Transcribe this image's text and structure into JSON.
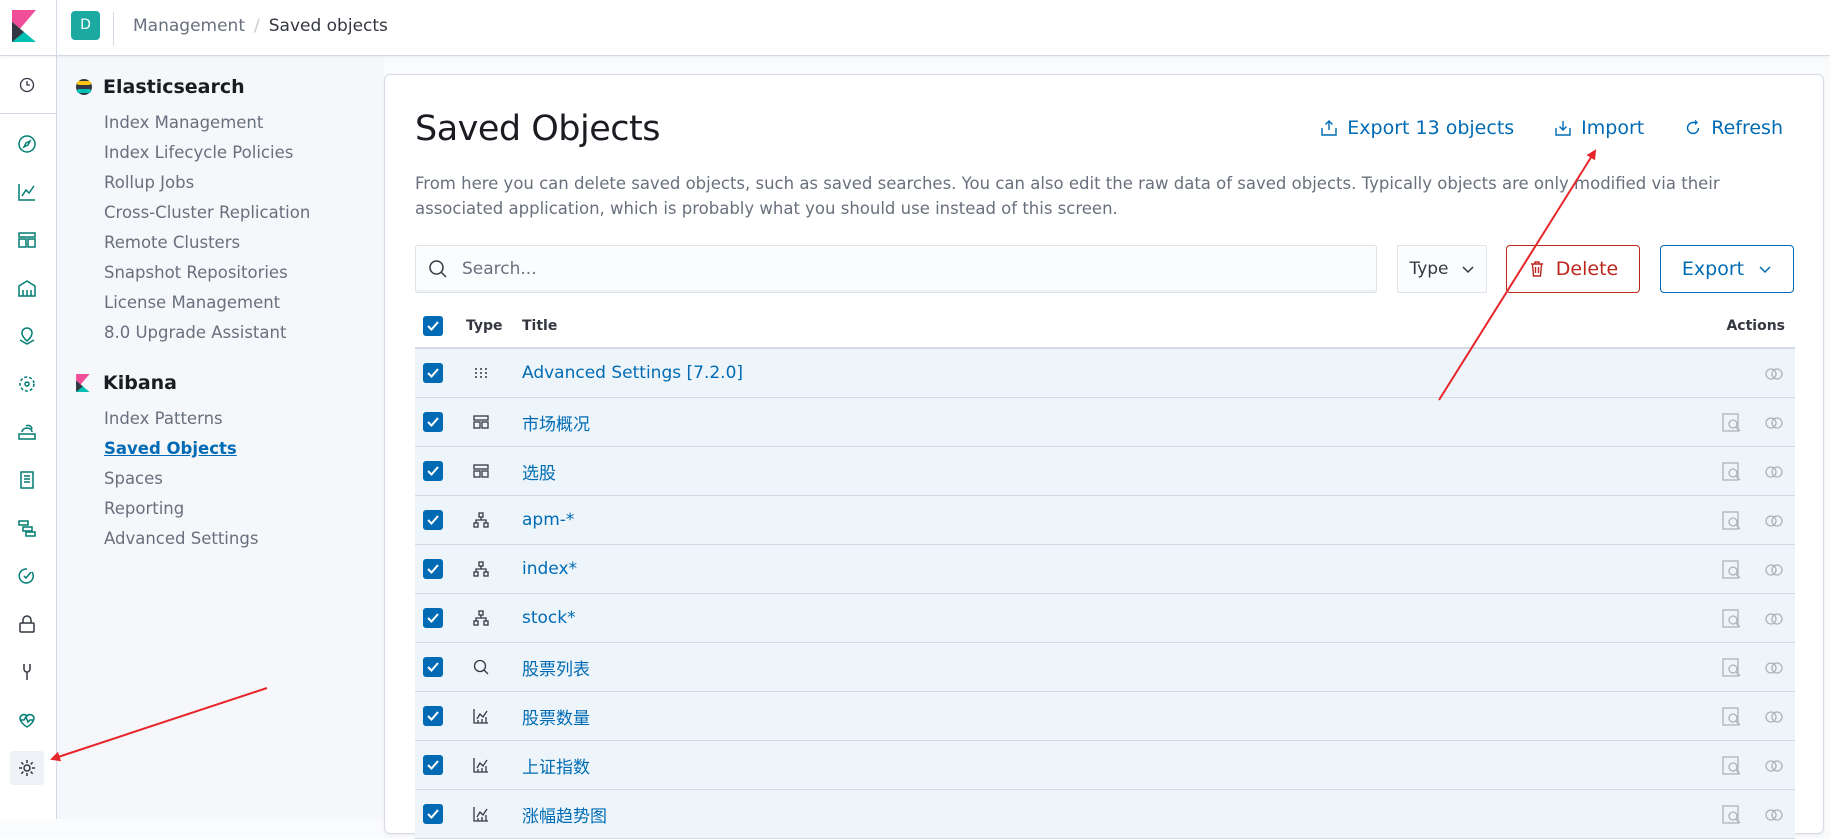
{
  "app": {
    "space_initial": "D"
  },
  "breadcrumbs": {
    "parent": "Management",
    "separator": "/",
    "current": "Saved objects"
  },
  "nav": {
    "items": [
      "clock-icon",
      "discover-icon",
      "visualize-icon",
      "dashboard-icon",
      "canvas-icon",
      "maps-icon",
      "ml-icon",
      "infrastructure-icon",
      "logs-icon",
      "apm-icon",
      "uptime-icon",
      "siem-icon",
      "dev-tools-icon",
      "monitoring-icon",
      "management-gear-icon"
    ]
  },
  "sidebar": {
    "elasticsearch": {
      "title": "Elasticsearch",
      "links": [
        "Index Management",
        "Index Lifecycle Policies",
        "Rollup Jobs",
        "Cross-Cluster Replication",
        "Remote Clusters",
        "Snapshot Repositories",
        "License Management",
        "8.0 Upgrade Assistant"
      ]
    },
    "kibana": {
      "title": "Kibana",
      "links": [
        "Index Patterns",
        "Saved Objects",
        "Spaces",
        "Reporting",
        "Advanced Settings"
      ],
      "selected": "Saved Objects"
    }
  },
  "main": {
    "title": "Saved Objects",
    "actions": {
      "export_all": "Export 13 objects",
      "import": "Import",
      "refresh": "Refresh"
    },
    "description": "From here you can delete saved objects, such as saved searches. You can also edit the raw data of saved objects. Typically objects are only modified via their associated application, which is probably what you should use instead of this screen.",
    "search": {
      "placeholder": "Search...",
      "value": ""
    },
    "type_filter": "Type",
    "delete_label": "Delete",
    "export_label": "Export"
  },
  "table": {
    "headers": {
      "type": "Type",
      "title": "Title",
      "actions": "Actions"
    },
    "rows": [
      {
        "type": "config",
        "title": "Advanced Settings [7.2.0]"
      },
      {
        "type": "dashboard",
        "title": "市场概况"
      },
      {
        "type": "dashboard",
        "title": "选股"
      },
      {
        "type": "index-pattern",
        "title": "apm-*"
      },
      {
        "type": "index-pattern",
        "title": "index*"
      },
      {
        "type": "index-pattern",
        "title": "stock*"
      },
      {
        "type": "search",
        "title": "股票列表"
      },
      {
        "type": "visualization",
        "title": "股票数量"
      },
      {
        "type": "visualization",
        "title": "上证指数"
      },
      {
        "type": "visualization",
        "title": "涨幅趋势图"
      }
    ]
  },
  "colors": {
    "accent": "#006bb4",
    "danger": "#bd271e",
    "annotation_arrow": "#e7262b"
  }
}
